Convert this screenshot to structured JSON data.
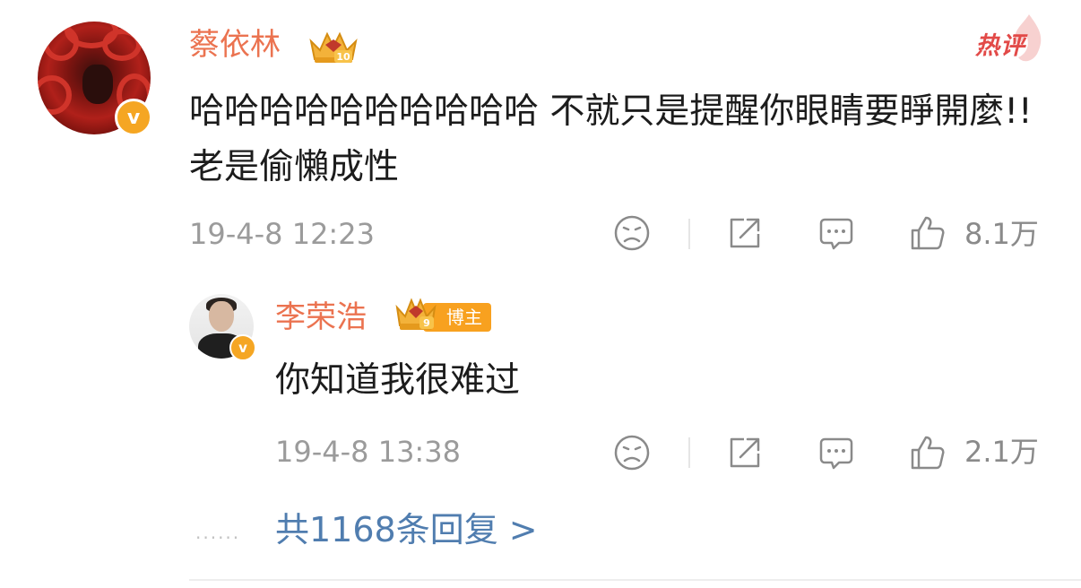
{
  "comment": {
    "author": "蔡依林",
    "hot_label": "热评",
    "text": "哈哈哈哈哈哈哈哈哈哈 不就只是提醒你眼睛要睜開麼!! 老是偷懶成性",
    "timestamp": "19-4-8 12:23",
    "like_count": "8.1万",
    "verified_icon": "v-badge-icon",
    "level_badge": "10",
    "level_icon": "crown-icon"
  },
  "reply": {
    "author": "李荣浩",
    "blogger_tag": "博主",
    "text": "你知道我很难过",
    "timestamp": "19-4-8 13:38",
    "like_count": "2.1万",
    "verified_icon": "v-badge-icon",
    "level_badge": "9",
    "level_icon": "crown-icon"
  },
  "footer": {
    "dots": "......",
    "more_replies": "共1168条回复 >"
  },
  "colors": {
    "name": "#eb7350",
    "hot": "#e24a48",
    "link": "#507daf",
    "meta": "#9b9b9b",
    "verified": "#f5a623"
  }
}
